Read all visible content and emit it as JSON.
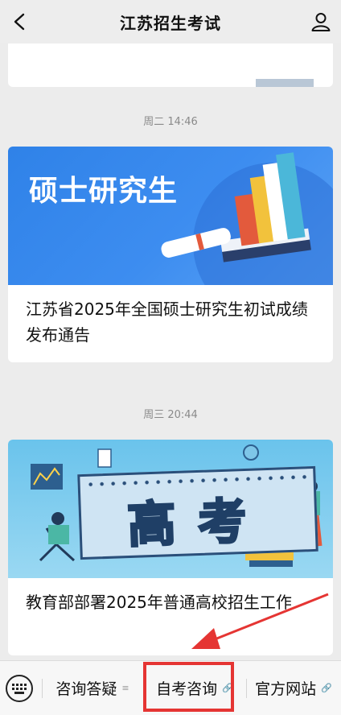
{
  "header": {
    "title": "江苏招生考试",
    "back_icon": "chevron-left-icon",
    "profile_icon": "person-icon"
  },
  "feed": [
    {
      "time": "周二 14:46",
      "cover_text": "硕士研究生",
      "title": "江苏省2025年全国硕士研究生初试成绩发布通告"
    },
    {
      "time": "周三 20:44",
      "cover_text": "高考",
      "title": "教育部部署2025年普通高校招生工作"
    }
  ],
  "bottom_menu": {
    "keyboard_icon": "keyboard-icon",
    "items": [
      {
        "label": "咨询答疑",
        "sub": "≡"
      },
      {
        "label": "自考咨询",
        "sub": "🔗"
      },
      {
        "label": "官方网站",
        "sub": "🔗"
      }
    ]
  },
  "colors": {
    "highlight": "#e53533",
    "arrow": "#e53533",
    "background": "#ececec"
  }
}
